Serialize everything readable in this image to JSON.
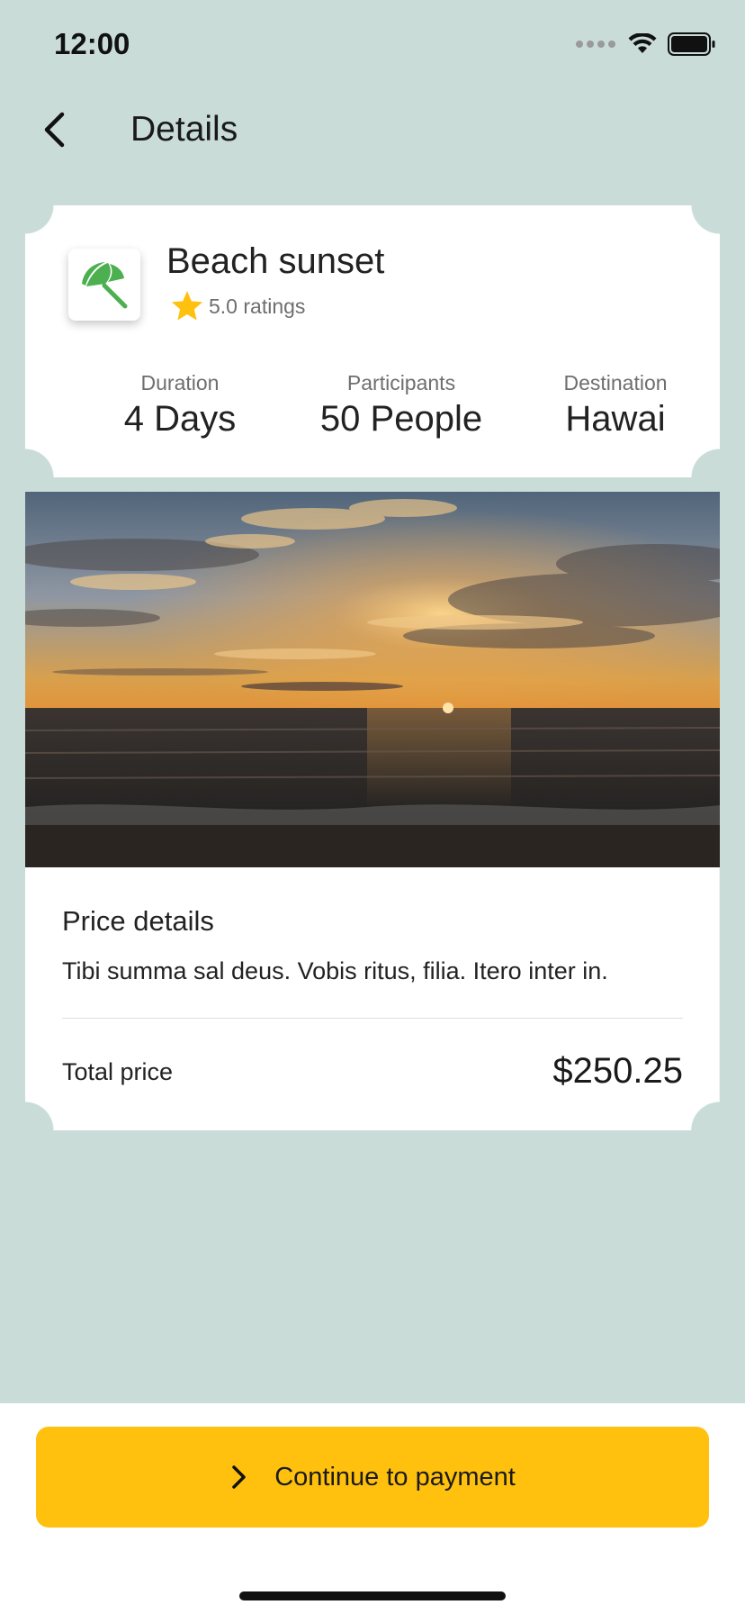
{
  "status_bar": {
    "time": "12:00"
  },
  "header": {
    "title": "Details",
    "back_icon": "chevron-left-icon"
  },
  "trip": {
    "icon": "beach-umbrella-icon",
    "icon_color": "#4CAF50",
    "title": "Beach sunset",
    "rating": {
      "icon": "star-icon",
      "star_color": "#FFC10E",
      "text": "5.0 ratings"
    },
    "stats": [
      {
        "label": "Duration",
        "value": "4 Days"
      },
      {
        "label": "Participants",
        "value": "50 People"
      },
      {
        "label": "Destination",
        "value": "Hawai"
      }
    ]
  },
  "price": {
    "heading": "Price details",
    "description": "Tibi summa sal deus. Vobis ritus, filia. Itero inter in.",
    "total_label": "Total price",
    "total_value": "$250.25"
  },
  "cta": {
    "label": "Continue to payment",
    "icon": "chevron-right-icon",
    "color": "#FFC10E"
  },
  "theme": {
    "background": "#C9DCD8"
  }
}
